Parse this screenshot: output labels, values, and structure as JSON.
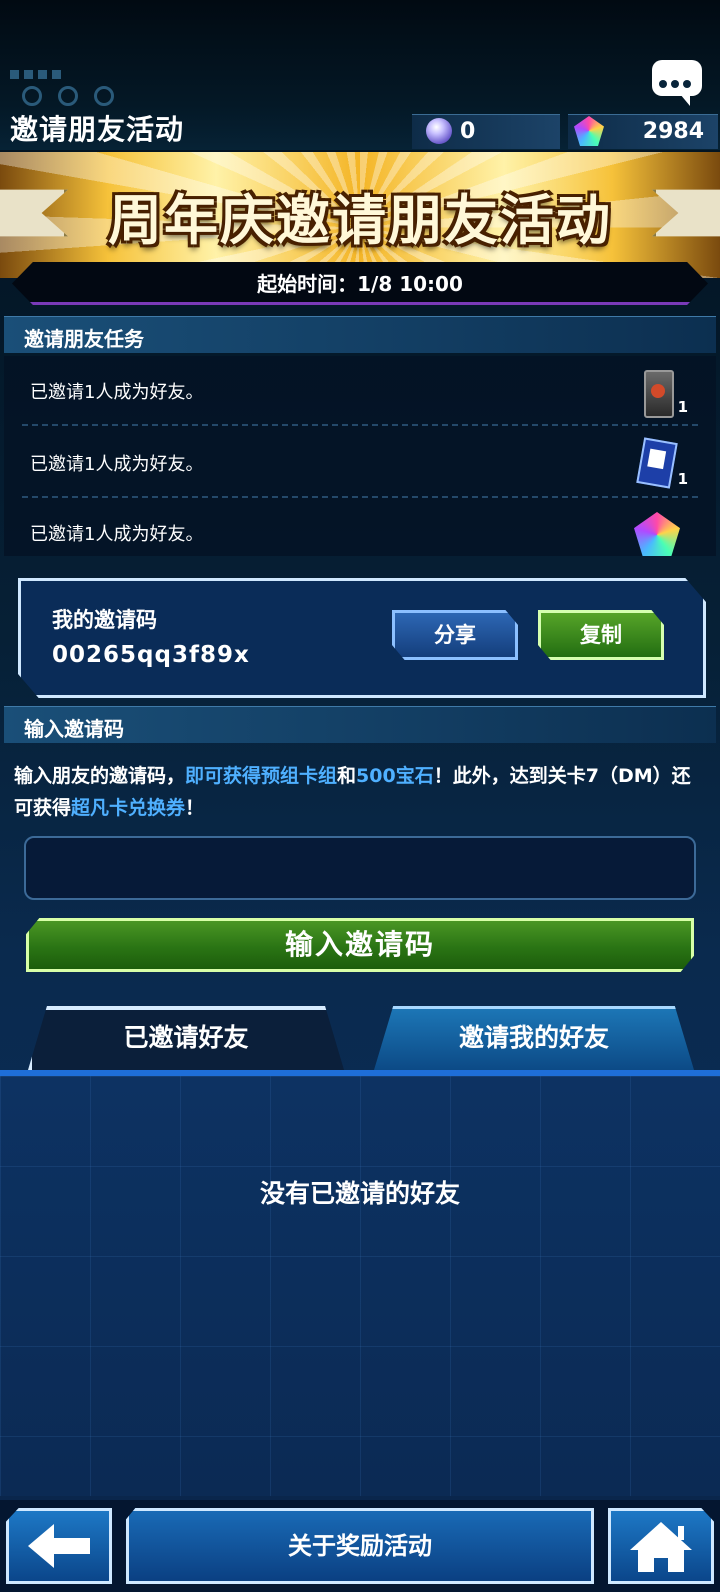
{
  "header": {
    "title": "邀请朋友活动",
    "orb_count": "0",
    "gem_count": "2984"
  },
  "banner": {
    "title": "周年庆邀请朋友活动",
    "start_time": "起始时间：1/8 10:00"
  },
  "missions": {
    "section_title": "邀请朋友任务",
    "items": [
      {
        "text": "已邀请1人成为好友。",
        "reward_icon": "card-pack-icon",
        "qty": "1"
      },
      {
        "text": "已邀请1人成为好友。",
        "reward_icon": "card-ticket-icon",
        "qty": "1"
      },
      {
        "text": "已邀请1人成为好友。",
        "reward_icon": "gem-icon",
        "qty": ""
      }
    ]
  },
  "invite_code": {
    "label": "我的邀请码",
    "code": "00265qq3f89x",
    "share_label": "分享",
    "copy_label": "复制"
  },
  "enter_code": {
    "section_title": "输入邀请码",
    "desc_1": "输入朋友的邀请码，",
    "desc_hl_1": "即可获得预组卡组",
    "desc_2": "和",
    "desc_hl_2": "500宝石",
    "desc_3": "！此外，达到关卡7（DM）还可获得",
    "desc_hl_3": "超凡卡兑换券",
    "desc_4": "！",
    "input_value": "",
    "button_label": "输入邀请码"
  },
  "tabs": {
    "active_label": "已邀请好友",
    "inactive_label": "邀请我的好友",
    "empty_message": "没有已邀请的好友"
  },
  "bottom": {
    "about_label": "关于奖励活动"
  },
  "colors": {
    "accent_green": "#2a7414",
    "accent_blue": "#1e6ed8",
    "highlight_text": "#4fb0ff"
  }
}
